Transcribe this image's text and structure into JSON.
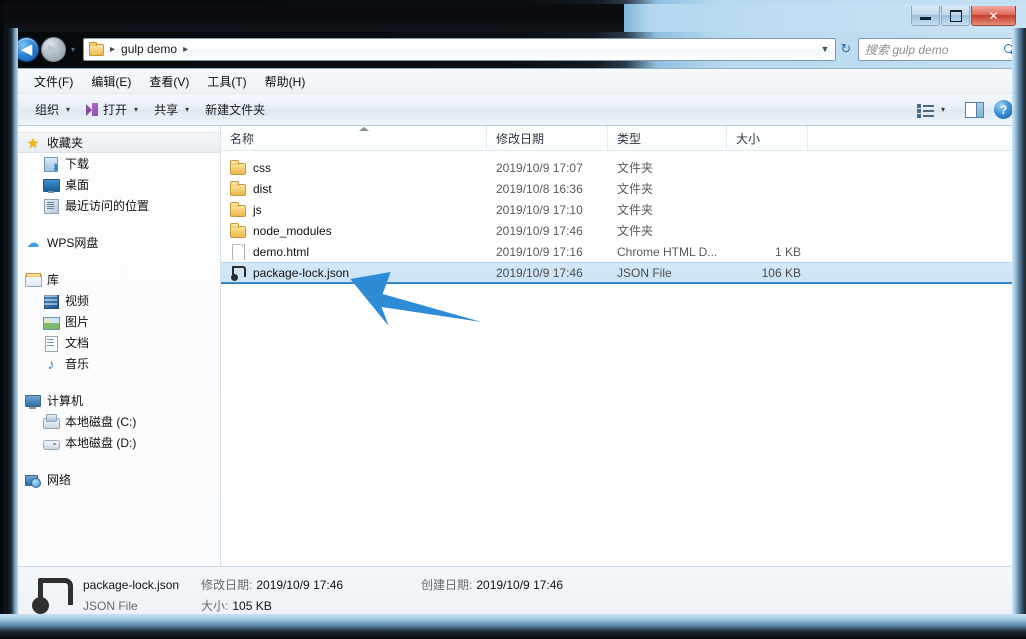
{
  "window": {
    "controls": {
      "minimize": "minimize-button",
      "maximize": "maximize-button",
      "close_label": "✕"
    }
  },
  "nav": {
    "back_glyph": "◀",
    "forward_glyph": "▶",
    "dropdown_glyph": "▾",
    "breadcrumb": {
      "sep1": "▸",
      "path": "gulp demo",
      "sep2": "▸"
    },
    "address_caret": "▼",
    "refresh_glyph": "↻"
  },
  "search": {
    "placeholder": "搜索 gulp demo"
  },
  "menubar": {
    "items": [
      {
        "label": "文件(F)"
      },
      {
        "label": "编辑(E)"
      },
      {
        "label": "查看(V)"
      },
      {
        "label": "工具(T)"
      },
      {
        "label": "帮助(H)"
      }
    ]
  },
  "toolbar": {
    "organize": "组织",
    "open": "打开",
    "share": "共享",
    "new_folder": "新建文件夹",
    "caret": "▾",
    "help_glyph": "?"
  },
  "sidebar": {
    "groups": [
      {
        "header": {
          "label": "收藏夹",
          "icon": "star-icon",
          "selected": true
        },
        "items": [
          {
            "label": "下载",
            "icon": "download-icon"
          },
          {
            "label": "桌面",
            "icon": "desktop-icon"
          },
          {
            "label": "最近访问的位置",
            "icon": "recent-places-icon"
          }
        ]
      },
      {
        "header": {
          "label": "WPS网盘",
          "icon": "cloud-icon",
          "selected": false
        },
        "items": []
      },
      {
        "header": {
          "label": "库",
          "icon": "library-icon",
          "selected": false
        },
        "items": [
          {
            "label": "视频",
            "icon": "video-icon"
          },
          {
            "label": "图片",
            "icon": "picture-icon"
          },
          {
            "label": "文档",
            "icon": "document-icon"
          },
          {
            "label": "音乐",
            "icon": "music-icon"
          }
        ]
      },
      {
        "header": {
          "label": "计算机",
          "icon": "computer-icon",
          "selected": false
        },
        "items": [
          {
            "label": "本地磁盘 (C:)",
            "icon": "disk-c-icon"
          },
          {
            "label": "本地磁盘 (D:)",
            "icon": "disk-d-icon"
          }
        ]
      },
      {
        "header": {
          "label": "网络",
          "icon": "network-icon",
          "selected": false
        },
        "items": []
      }
    ]
  },
  "filelist": {
    "columns": [
      {
        "key": "name",
        "label": "名称"
      },
      {
        "key": "date",
        "label": "修改日期"
      },
      {
        "key": "type",
        "label": "类型"
      },
      {
        "key": "size",
        "label": "大小"
      }
    ],
    "sorted_by": "名称",
    "rows": [
      {
        "name": "css",
        "date": "2019/10/9 17:07",
        "type": "文件夹",
        "size": "",
        "icon": "folder-icon",
        "selected": false
      },
      {
        "name": "dist",
        "date": "2019/10/8 16:36",
        "type": "文件夹",
        "size": "",
        "icon": "folder-icon",
        "selected": false
      },
      {
        "name": "js",
        "date": "2019/10/9 17:10",
        "type": "文件夹",
        "size": "",
        "icon": "folder-icon",
        "selected": false
      },
      {
        "name": "node_modules",
        "date": "2019/10/9 17:46",
        "type": "文件夹",
        "size": "",
        "icon": "folder-icon",
        "selected": false
      },
      {
        "name": "demo.html",
        "date": "2019/10/9 17:16",
        "type": "Chrome HTML D...",
        "size": "1 KB",
        "icon": "html-file-icon",
        "selected": false
      },
      {
        "name": "package-lock.json",
        "date": "2019/10/9 17:46",
        "type": "JSON File",
        "size": "106 KB",
        "icon": "json-file-icon",
        "selected": true
      }
    ]
  },
  "annotation": {
    "arrow_color": "#2e8bd6"
  },
  "details": {
    "file_name": "package-lock.json",
    "file_kind": "JSON File",
    "modified_label": "修改日期:",
    "modified_value": "2019/10/9 17:46",
    "created_label": "创建日期:",
    "created_value": "2019/10/9 17:46",
    "size_label": "大小:",
    "size_value": "105 KB"
  }
}
